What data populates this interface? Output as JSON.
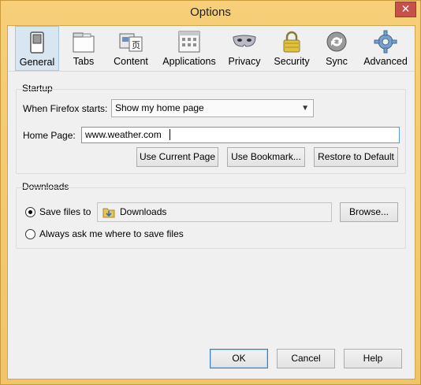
{
  "window": {
    "title": "Options",
    "close_glyph": "✕"
  },
  "toolbar": {
    "tabs": [
      {
        "label": "General",
        "icon": "switch-icon",
        "active": true
      },
      {
        "label": "Tabs",
        "icon": "tabs-icon"
      },
      {
        "label": "Content",
        "icon": "content-icon"
      },
      {
        "label": "Applications",
        "icon": "applications-icon"
      },
      {
        "label": "Privacy",
        "icon": "mask-icon"
      },
      {
        "label": "Security",
        "icon": "lock-icon"
      },
      {
        "label": "Sync",
        "icon": "sync-icon"
      },
      {
        "label": "Advanced",
        "icon": "gear-icon"
      }
    ]
  },
  "startup": {
    "group_title": "Startup",
    "when_starts_label": "When Firefox starts:",
    "when_starts_value": "Show my home page",
    "home_page_label": "Home Page:",
    "home_page_value": "www.weather.com",
    "use_current_label": "Use Current Page",
    "use_bookmark_label": "Use Bookmark...",
    "restore_default_label": "Restore to Default"
  },
  "downloads": {
    "group_title": "Downloads",
    "save_files_label": "Save files to",
    "save_folder": "Downloads",
    "browse_label": "Browse...",
    "always_ask_label": "Always ask me where to save files",
    "selected_option": "save_files"
  },
  "footer": {
    "ok_label": "OK",
    "cancel_label": "Cancel",
    "help_label": "Help"
  }
}
